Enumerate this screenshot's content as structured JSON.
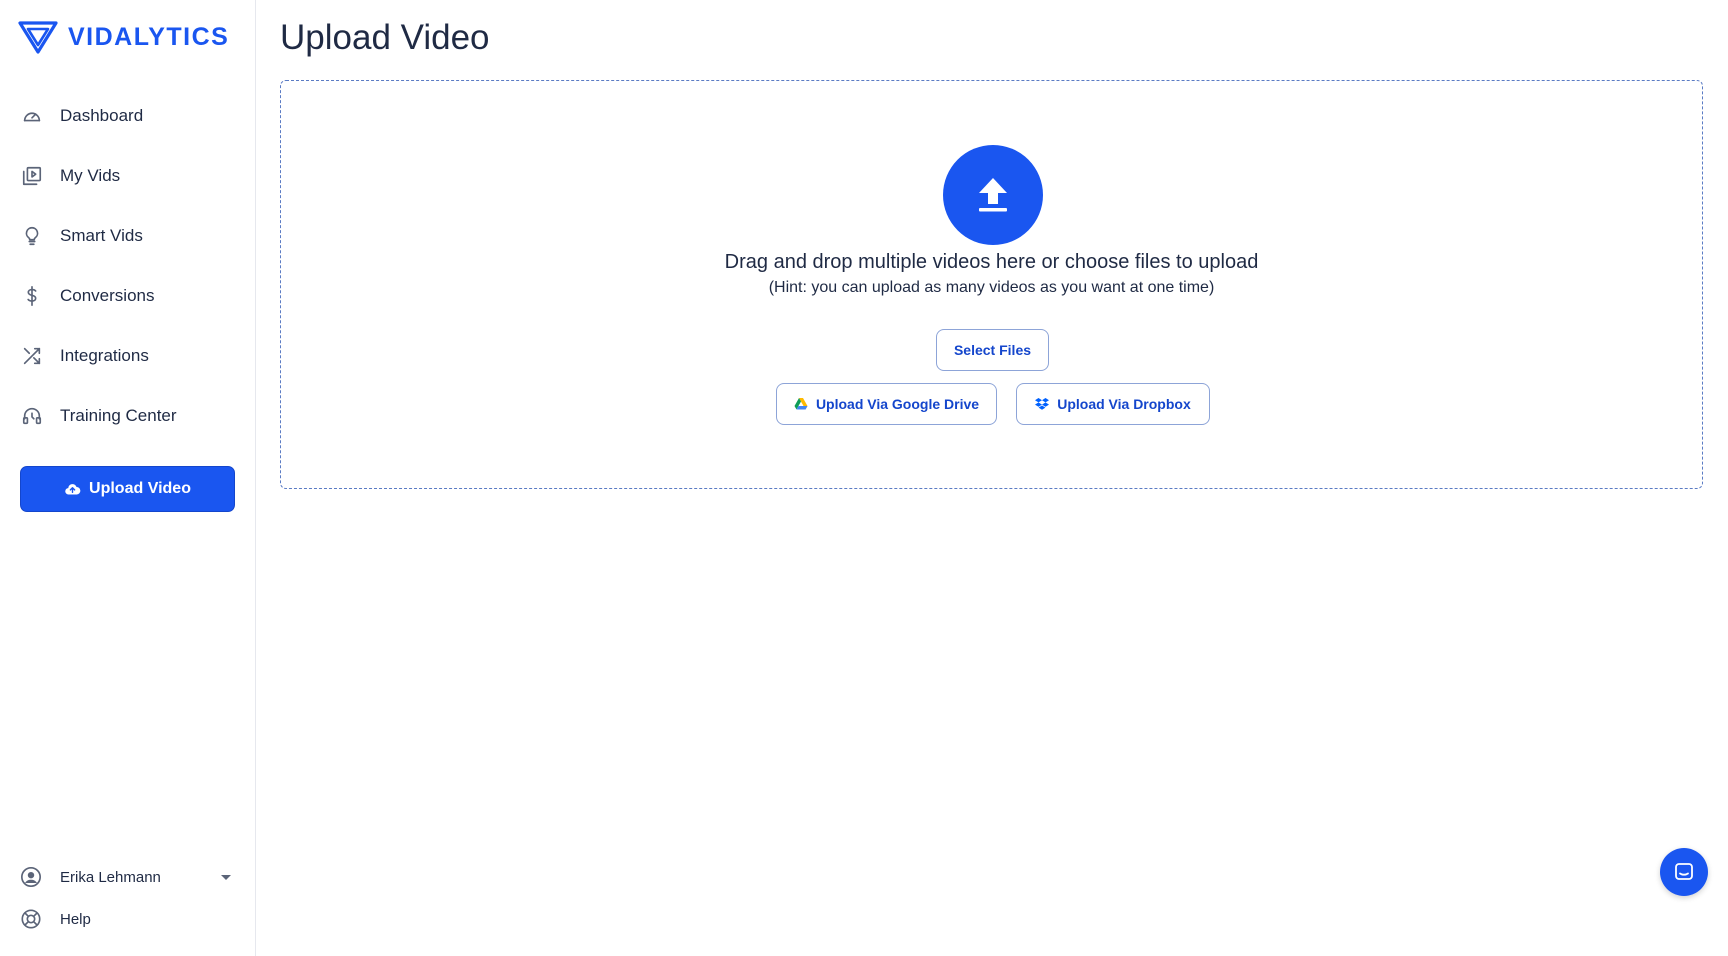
{
  "brand": {
    "name": "VIDALYTICS",
    "color": "#1a56f0"
  },
  "sidebar": {
    "items": [
      {
        "label": "Dashboard",
        "icon": "gauge-icon"
      },
      {
        "label": "My Vids",
        "icon": "video-library-icon"
      },
      {
        "label": "Smart Vids",
        "icon": "lightbulb-icon"
      },
      {
        "label": "Conversions",
        "icon": "dollar-icon"
      },
      {
        "label": "Integrations",
        "icon": "shuffle-icon"
      },
      {
        "label": "Training Center",
        "icon": "headset-icon"
      }
    ],
    "upload_button": "Upload Video",
    "user_name": "Erika Lehmann",
    "help_label": "Help"
  },
  "main": {
    "title": "Upload Video",
    "dropzone": {
      "primary_text": "Drag and drop multiple videos here or choose files to upload",
      "hint_text": "(Hint: you can upload as many videos as you want at one time)",
      "select_files": "Select Files",
      "google_drive": "Upload Via Google Drive",
      "dropbox": "Upload Via Dropbox"
    }
  }
}
